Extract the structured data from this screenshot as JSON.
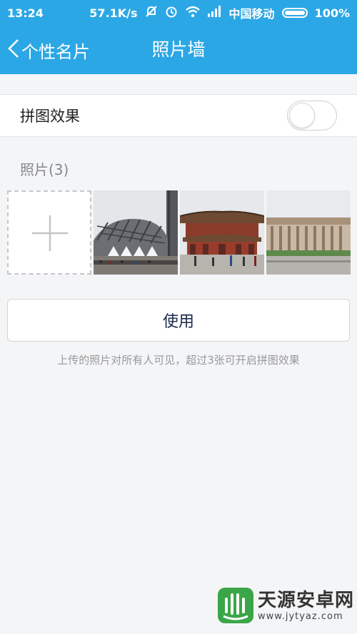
{
  "status_bar": {
    "time": "13:24",
    "speed": "57.1K/s",
    "carrier": "中国移动",
    "battery": "100%",
    "icons": [
      "mute-icon",
      "alarm-icon",
      "wifi-icon",
      "signal-icon",
      "battery-icon"
    ]
  },
  "header": {
    "back_label": "个性名片",
    "title": "照片墙",
    "background": "#2ca7e6"
  },
  "collage": {
    "label": "拼图效果",
    "enabled": false
  },
  "photos": {
    "title": "照片(3)",
    "count": 3
  },
  "use_button": {
    "label": "使用"
  },
  "hint": "上传的照片对所有人可见，超过3张可开启拼图效果",
  "watermark": {
    "name": "天源安卓网",
    "url": "www.jytyaz.com"
  }
}
